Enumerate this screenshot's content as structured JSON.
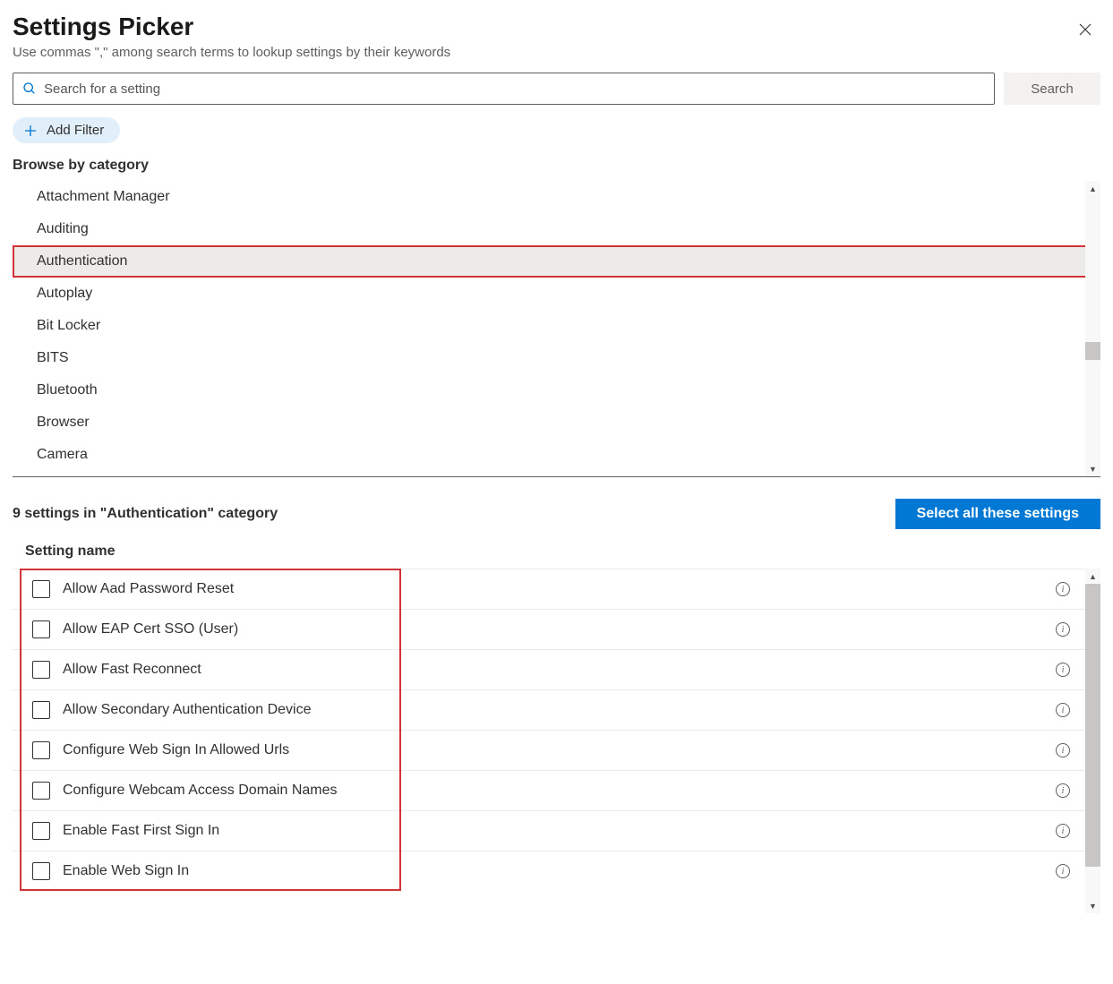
{
  "header": {
    "title": "Settings Picker",
    "subtitle": "Use commas \",\" among search terms to lookup settings by their keywords"
  },
  "search": {
    "placeholder": "Search for a setting",
    "button": "Search"
  },
  "addFilter": "Add Filter",
  "browseHeading": "Browse by category",
  "categories": [
    "Attachment Manager",
    "Auditing",
    "Authentication",
    "Autoplay",
    "Bit Locker",
    "BITS",
    "Bluetooth",
    "Browser",
    "Camera"
  ],
  "selectedCategoryIndex": 2,
  "results": {
    "countText": "9 settings in \"Authentication\" category",
    "selectAll": "Select all these settings",
    "columnHeader": "Setting name",
    "items": [
      "Allow Aad Password Reset",
      "Allow EAP Cert SSO (User)",
      "Allow Fast Reconnect",
      "Allow Secondary Authentication Device",
      "Configure Web Sign In Allowed Urls",
      "Configure Webcam Access Domain Names",
      "Enable Fast First Sign In",
      "Enable Web Sign In"
    ]
  }
}
